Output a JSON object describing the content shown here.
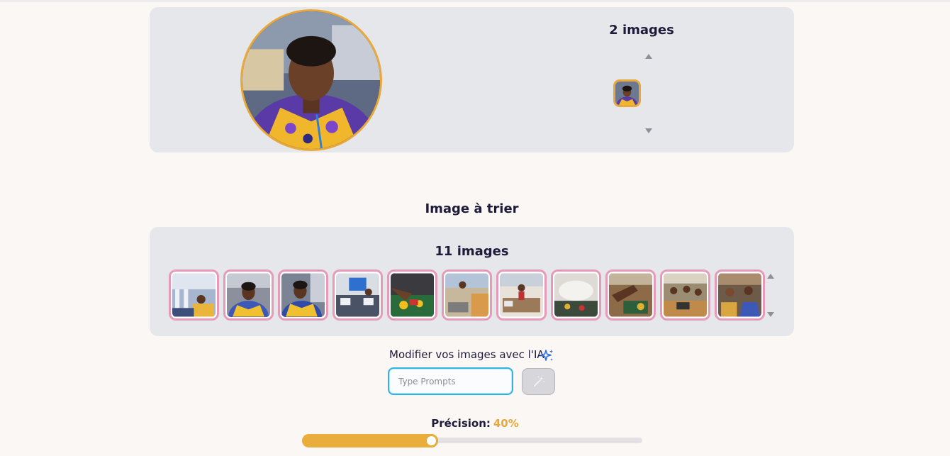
{
  "top_gallery": {
    "count_label": "2 images"
  },
  "sort_section": {
    "title": "Image à trier",
    "count_label": "11 images",
    "thumbnails": [
      {
        "name": "thumb-1"
      },
      {
        "name": "thumb-2"
      },
      {
        "name": "thumb-3"
      },
      {
        "name": "thumb-4"
      },
      {
        "name": "thumb-5"
      },
      {
        "name": "thumb-6"
      },
      {
        "name": "thumb-7"
      },
      {
        "name": "thumb-8"
      },
      {
        "name": "thumb-9"
      },
      {
        "name": "thumb-10"
      },
      {
        "name": "thumb-11"
      }
    ]
  },
  "ai_edit": {
    "label": "Modifier vos images avec l'IA",
    "icon": "sparkles-icon",
    "prompt_placeholder": "Type Prompts",
    "prompt_value": "",
    "submit_icon": "magic-wand-icon"
  },
  "precision": {
    "label": "Précision:",
    "value_text": "40%",
    "value": 0.4
  },
  "colors": {
    "accent_orange": "#e9a93a",
    "thumb_border_pink": "#e79ab8",
    "input_focus_blue": "#33b4e0"
  }
}
